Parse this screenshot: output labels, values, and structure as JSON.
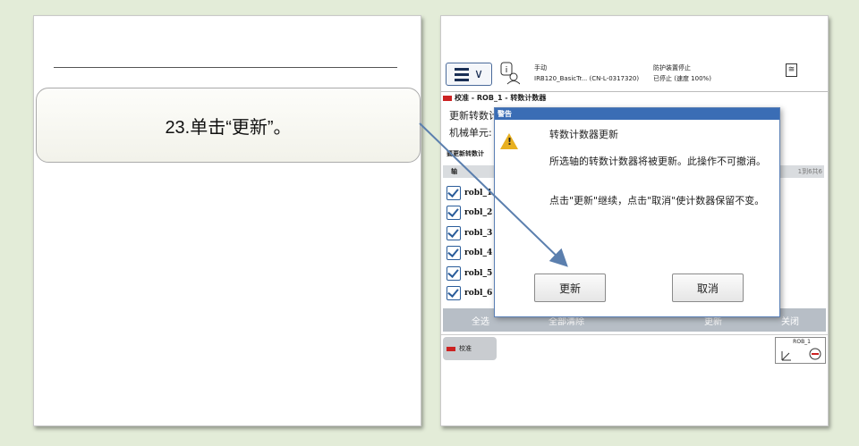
{
  "instruction": {
    "text": "23.单击“更新”。"
  },
  "robot": {
    "menu_icon": "hamburger-menu-icon",
    "status": {
      "mode": "手动",
      "system": "IRB120_BasicTr...  (CN-L-0317320)",
      "safety": "防护装置停止",
      "state": "已停止 (速度 100%)"
    },
    "close_symbol": "≅",
    "breadcrumb": "校准 - ROB_1 - 转数计数器",
    "labels": {
      "update_counters": "更新转数计",
      "mech_unit": "机械单元:"
    },
    "list_heading": "要更新转数计",
    "column_axis": "轴",
    "right_header_fragment": "1到6共6",
    "rows": [
      "robl_1",
      "robl_2",
      "robl_3",
      "robl_4",
      "robl_5",
      "robl_6"
    ],
    "bottom": {
      "select_all": "全选",
      "clear_all": "全部清除",
      "update": "更新",
      "close": "关闭"
    },
    "taskbar": {
      "calibration": "校准",
      "jog_label": "ROB_1"
    },
    "dialog": {
      "title": "警告",
      "heading": "转数计数器更新",
      "body1": "所选轴的转数计数器将被更新。此操作不可撤消。",
      "body2": "点击\"更新\"继续，点击\"取消\"使计数器保留不变。",
      "update_button": "更新",
      "cancel_button": "取消"
    }
  }
}
